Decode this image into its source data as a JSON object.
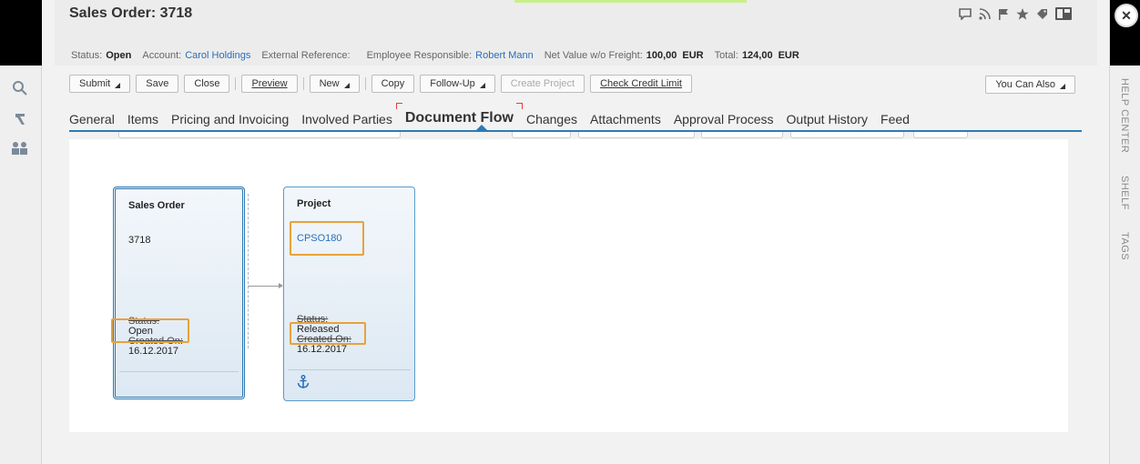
{
  "window": {
    "title": "Sales Order: 3718",
    "close_label": "✕"
  },
  "header_icons": [
    "message-icon",
    "rss-icon",
    "flag-icon",
    "star-icon",
    "tag-icon",
    "tile-icon"
  ],
  "info": {
    "status_label": "Status:",
    "status_value": "Open",
    "account_label": "Account:",
    "account_value": "Carol Holdings",
    "ext_ref_label": "External Reference:",
    "ext_ref_value": "",
    "employee_label": "Employee Responsible:",
    "employee_value": "Robert Mann",
    "net_value_label": "Net Value w/o Freight:",
    "net_value": "100,00",
    "net_currency": "EUR",
    "total_label": "Total:",
    "total_value": "124,00",
    "total_currency": "EUR"
  },
  "toolbar": {
    "submit": "Submit",
    "save": "Save",
    "close": "Close",
    "preview": "Preview",
    "new": "New",
    "copy": "Copy",
    "follow_up": "Follow-Up",
    "create_project": "Create Project",
    "check_credit": "Check Credit Limit",
    "you_can_also": "You Can Also"
  },
  "tabs": [
    {
      "label": "General"
    },
    {
      "label": "Items"
    },
    {
      "label": "Pricing and Invoicing"
    },
    {
      "label": "Involved Parties"
    },
    {
      "label": "Document Flow",
      "active": true
    },
    {
      "label": "Changes"
    },
    {
      "label": "Attachments"
    },
    {
      "label": "Approval Process"
    },
    {
      "label": "Output History"
    },
    {
      "label": "Feed"
    }
  ],
  "right_rail": {
    "help": "HELP CENTER",
    "shelf": "SHELF",
    "tags": "TAGS"
  },
  "flow": {
    "sales_order": {
      "title": "Sales Order",
      "id": "3718",
      "status_label": "Status:",
      "status": "Open",
      "created_label": "Created On:",
      "created": "16.12.2017"
    },
    "project": {
      "title": "Project",
      "id": "CPSO180",
      "status_label": "Status:",
      "status": "Released",
      "created_label": "Created On:",
      "created": "16.12.2017"
    }
  },
  "colors": {
    "accent": "#2c7bb6",
    "link": "#2a6ebb",
    "highlight": "#e8a23a"
  }
}
